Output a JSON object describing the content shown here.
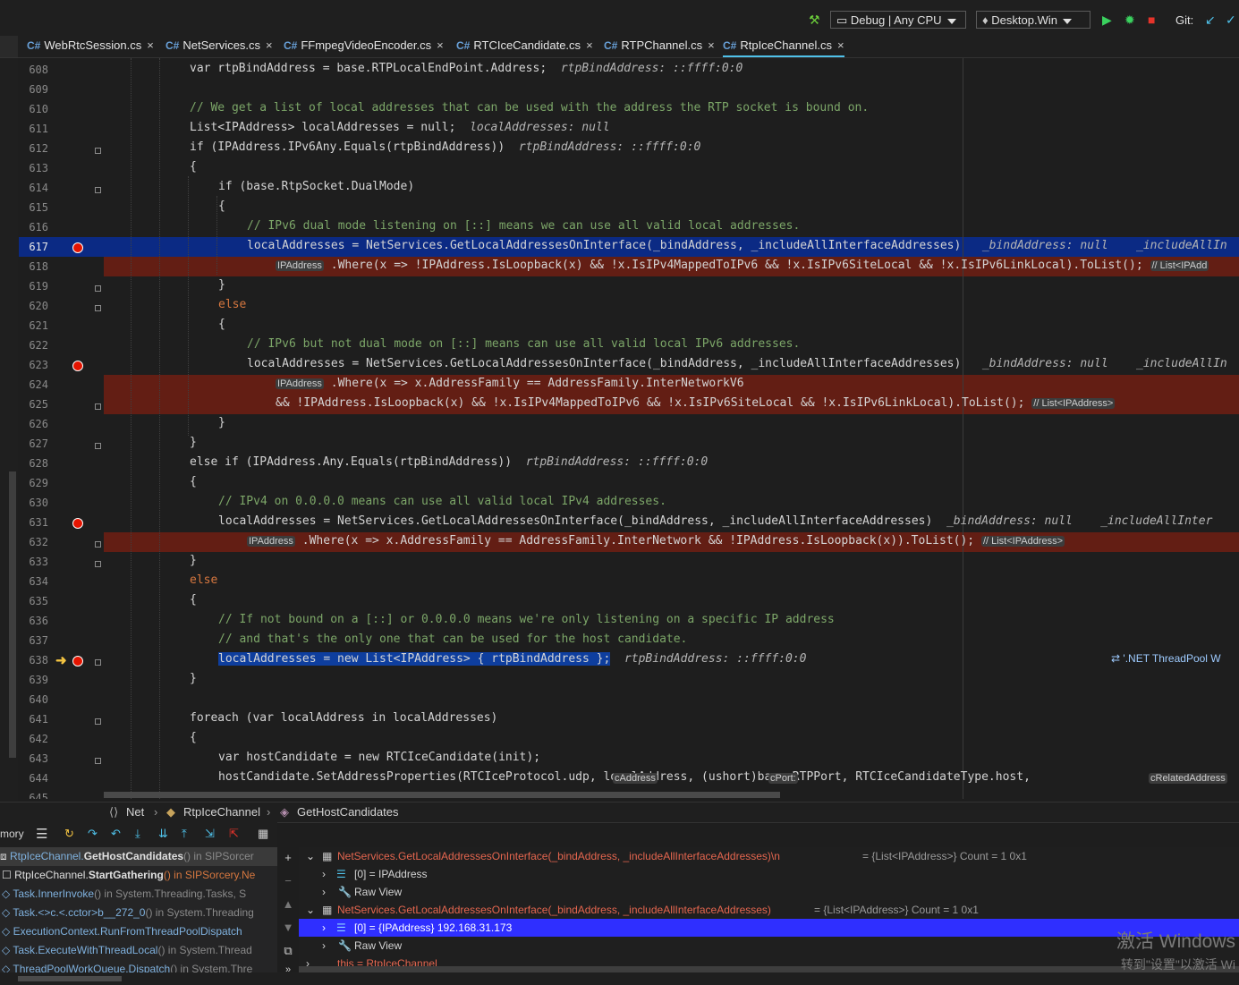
{
  "toolbar": {
    "config": "Debug | Any CPU",
    "target": "Desktop.Win",
    "git_label": "Git:"
  },
  "tabs": [
    {
      "label": "WebRtcSession.cs"
    },
    {
      "label": "NetServices.cs"
    },
    {
      "label": "FFmpegVideoEncoder.cs"
    },
    {
      "label": "RTCIceCandidate.cs"
    },
    {
      "label": "RTPChannel.cs"
    },
    {
      "label": "RtpIceChannel.cs"
    }
  ],
  "lines": [
    "608",
    "609",
    "610",
    "611",
    "612",
    "613",
    "614",
    "615",
    "616",
    "617",
    "618",
    "619",
    "620",
    "621",
    "622",
    "623",
    "624",
    "625",
    "626",
    "627",
    "628",
    "629",
    "630",
    "631",
    "632",
    "633",
    "634",
    "635",
    "636",
    "637",
    "638",
    "639",
    "640",
    "641",
    "642",
    "643",
    "644",
    "645"
  ],
  "code": {
    "l608": "var rtpBindAddress = base.RTPLocalEndPoint.Address;",
    "l608_hint": "rtpBindAddress: ::ffff:0:0",
    "l610": "// We get a list of local addresses that can be used with the address the RTP socket is bound on.",
    "l611": "List<IPAddress> localAddresses = null;",
    "l611_hint": "localAddresses: null",
    "l612": "if (IPAddress.IPv6Any.Equals(rtpBindAddress))",
    "l612_hint": "rtpBindAddress: ::ffff:0:0",
    "l613": "{",
    "l614": "if (base.RtpSocket.DualMode)",
    "l615": "{",
    "l616": "// IPv6 dual mode listening on [::] means we can use all valid local addresses.",
    "l617": "localAddresses = NetServices.GetLocalAddressesOnInterface(_bindAddress, _includeAllInterfaceAddresses)",
    "l617_hint": "_bindAddress: null    _includeAllIn",
    "l618_param": "IPAddress",
    "l618": ".Where(x => !IPAddress.IsLoopback(x) && !x.IsIPv4MappedToIPv6 && !x.IsIPv6SiteLocal && !x.IsIPv6LinkLocal).ToList();",
    "l618_hint": "// List<IPAdd",
    "l619": "}",
    "l620": "else",
    "l621": "{",
    "l622": "// IPv6 but not dual mode on [::] means can use all valid local IPv6 addresses.",
    "l623": "localAddresses = NetServices.GetLocalAddressesOnInterface(_bindAddress, _includeAllInterfaceAddresses)",
    "l623_hint": "_bindAddress: null    _includeAllIn",
    "l624_param": "IPAddress",
    "l624": ".Where(x => x.AddressFamily == AddressFamily.InterNetworkV6",
    "l625": "&& !IPAddress.IsLoopback(x) && !x.IsIPv4MappedToIPv6 && !x.IsIPv6SiteLocal && !x.IsIPv6LinkLocal).ToList();",
    "l625_hint": "// List<IPAddress>",
    "l626": "}",
    "l627": "}",
    "l628": "else if (IPAddress.Any.Equals(rtpBindAddress))",
    "l628_hint": "rtpBindAddress: ::ffff:0:0",
    "l629": "{",
    "l630": "// IPv4 on 0.0.0.0 means can use all valid local IPv4 addresses.",
    "l631": "localAddresses = NetServices.GetLocalAddressesOnInterface(_bindAddress, _includeAllInterfaceAddresses)",
    "l631_hint": "_bindAddress: null    _includeAllInter",
    "l632_param": "IPAddress",
    "l632": ".Where(x => x.AddressFamily == AddressFamily.InterNetwork && !IPAddress.IsLoopback(x)).ToList();",
    "l632_hint": "// List<IPAddress>",
    "l633": "}",
    "l634": "else",
    "l635": "{",
    "l636": "// If not bound on a [::] or 0.0.0.0 means we're only listening on a specific IP address",
    "l637": "// and that's the only one that can be used for the host candidate.",
    "l638": "localAddresses = new List<IPAddress> { rtpBindAddress };",
    "l638_hint": "rtpBindAddress: ::ffff:0:0",
    "l638_threadpool": "'.NET ThreadPool W",
    "l639": "}",
    "l641": "foreach (var localAddress in localAddresses)",
    "l642": "{",
    "l643": "var hostCandidate = new RTCIceCandidate(init);",
    "l644": "hostCandidate.SetAddressProperties(RTCIceProtocol.udp, localAddress, (ushort)base.RTPPort, RTCIceCandidateType.host,",
    "l644_p1": "cAddress",
    "l644_p2": "cPort:",
    "l644_p3": "cRelatedAddress"
  },
  "breadcrumb": {
    "namespace": "Net",
    "class": "RtpIceChannel",
    "method": "GetHostCandidates"
  },
  "bottom": {
    "left_label": "mory",
    "frames": [
      {
        "cls": "RtpIceChannel.",
        "method": "GetHostCandidates",
        "rest": "() in SIPSorcer"
      },
      {
        "cls": "RtpIceChannel.",
        "method": "StartGathering",
        "rest": "() in SIPSorcery.Ne"
      },
      {
        "cls": "Task.",
        "method": "InnerInvoke",
        "rest": "() in System.Threading.Tasks, S"
      },
      {
        "cls": "Task.<>c.<.",
        "method": "cctor>b__272_0",
        "rest": "() in System.Threading"
      },
      {
        "cls": "ExecutionContext.",
        "method": "RunFromThreadPoolDispatch",
        "rest": ""
      },
      {
        "cls": "Task.",
        "method": "ExecuteWithThreadLocal",
        "rest": "() in System.Thread"
      },
      {
        "cls": "ThreadPoolWorkQueue.",
        "method": "Dispatch",
        "rest": "() in System.Thre"
      }
    ],
    "watch": [
      {
        "text": "NetServices.GetLocalAddressesOnInterface(_bindAddress, _includeAllInterfaceAddresses)\\n",
        "value": "= {List<IPAddress>} Count = 1 0x1"
      },
      {
        "text": "[0] = IPAddress",
        "value": ""
      },
      {
        "text": "Raw View",
        "value": ""
      },
      {
        "text": "NetServices.GetLocalAddressesOnInterface(_bindAddress, _includeAllInterfaceAddresses)",
        "value": "= {List<IPAddress>} Count = 1 0x1"
      },
      {
        "text": "[0] = {IPAddress} 192.168.31.173",
        "value": ""
      },
      {
        "text": "Raw View",
        "value": ""
      },
      {
        "text": "this = RtpIceChannel",
        "value": ""
      }
    ]
  },
  "watermark": {
    "line1": "激活 Windows",
    "line2": "转到\"设置\"以激活 Wi"
  },
  "colors": {
    "accent": "#4fc1e9",
    "breakpoint": "#e51400",
    "current_line": "#0b2a84",
    "bp_line": "#631e14"
  }
}
